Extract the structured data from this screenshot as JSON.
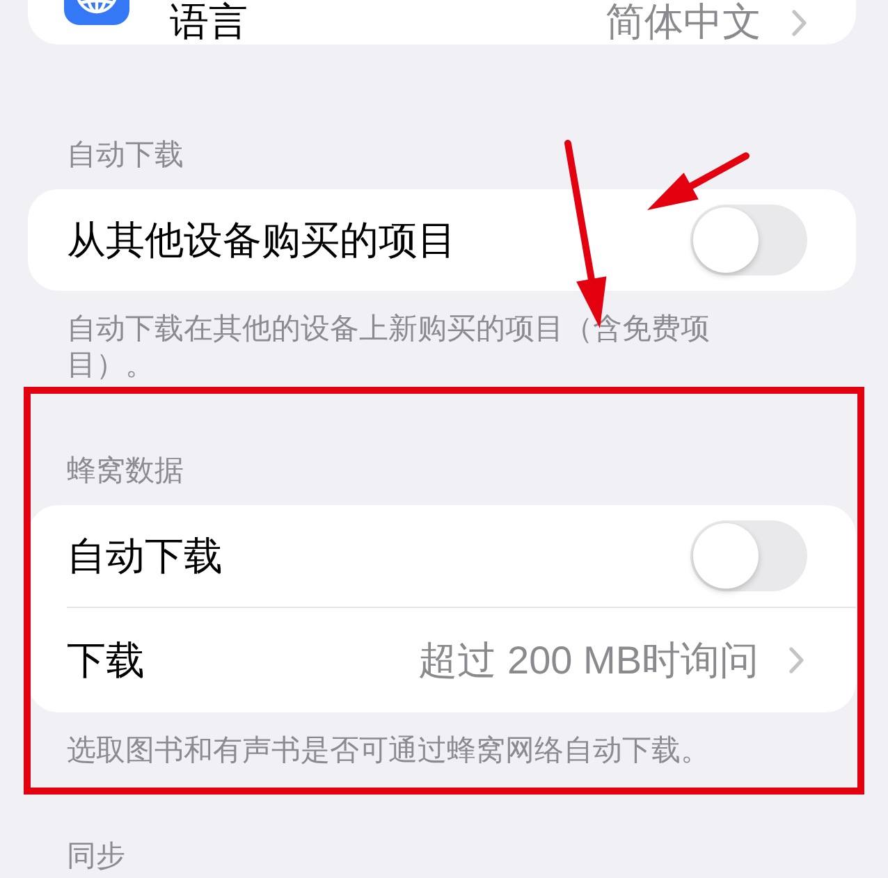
{
  "sections": [
    {
      "highlighted": false,
      "rows": [
        {
          "kind": "app-link",
          "label": "语言",
          "value": "简体中文"
        }
      ]
    },
    {
      "header": "自动下载",
      "highlighted": false,
      "rows": [
        {
          "kind": "toggle",
          "label": "从其他设备购买的项目",
          "on": false
        }
      ],
      "footer": "自动下载在其他的设备上新购买的项目（含免费项目）。"
    },
    {
      "header": "蜂窝数据",
      "highlighted": true,
      "rows": [
        {
          "kind": "toggle",
          "label": "自动下载",
          "on": false
        },
        {
          "kind": "link",
          "label": "下载",
          "value": "超过 200 MB时询问"
        }
      ],
      "footer": "选取图书和有声书是否可通过蜂窝网络自动下载。"
    },
    {
      "header": "同步",
      "highlighted": false
    }
  ],
  "annotations": [
    {
      "kind": "arrow"
    },
    {
      "kind": "arrow"
    }
  ]
}
